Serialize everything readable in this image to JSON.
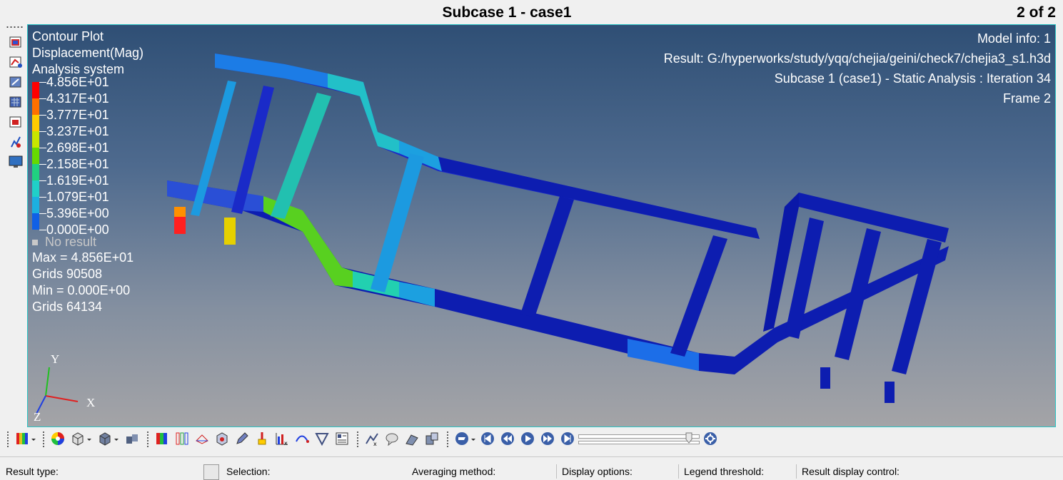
{
  "window": {
    "title": "Subcase 1 - case1",
    "page_count": "2 of 2"
  },
  "contour": {
    "title_lines": [
      "Contour Plot",
      "Displacement(Mag)",
      "Analysis system"
    ],
    "legend": [
      {
        "value": "4.856E+01",
        "color": "#ff0000"
      },
      {
        "value": "4.317E+01",
        "color": "#ff7000"
      },
      {
        "value": "3.777E+01",
        "color": "#ffcc00"
      },
      {
        "value": "3.237E+01",
        "color": "#c8e600"
      },
      {
        "value": "2.698E+01",
        "color": "#66d900"
      },
      {
        "value": "2.158E+01",
        "color": "#20d080"
      },
      {
        "value": "1.619E+01",
        "color": "#20d0c8"
      },
      {
        "value": "1.079E+01",
        "color": "#1cb0e0"
      },
      {
        "value": "5.396E+00",
        "color": "#1060e6"
      },
      {
        "value": "0.000E+00",
        "color": "#0a14a8"
      }
    ],
    "no_result": "No result",
    "stats": [
      "Max = 4.856E+01",
      "Grids 90508",
      "Min = 0.000E+00",
      "Grids 64134"
    ]
  },
  "model_info": [
    "Model info: 1",
    "Result: G:/hyperworks/study/yqq/chejia/geini/check7/chejia3_s1.h3d",
    "Subcase 1 (case1) - Static Analysis : Iteration 34",
    "Frame 2"
  ],
  "axes": {
    "y": "Y",
    "x": "X",
    "z": "Z"
  },
  "left_toolbar_icons": [
    "contour-icon",
    "deformed-icon",
    "vector-icon",
    "tensor-icon",
    "iso-icon",
    "tracing-icon",
    "display-icon"
  ],
  "bottom_toolbar_icons": [
    "contour-legend-icon",
    "color-wheel-icon",
    "mesh-style-icon",
    "shaded-icon",
    "visualization-icon",
    "contour-tool-icon",
    "iso-value-icon",
    "deformed-shape-icon",
    "vector-plot-icon",
    "edit-icon",
    "query-icon",
    "plot-icon",
    "tracing-icon",
    "measure-icon",
    "notes-icon",
    "xy-plot-icon",
    "comment-icon",
    "section-cut-icon",
    "transform-icon",
    "animation-mode-icon",
    "first-frame-icon",
    "previous-frame-icon",
    "play-icon",
    "next-frame-icon",
    "last-frame-icon",
    "animation-settings-icon"
  ],
  "panel": {
    "labels": [
      "Result type:",
      "Selection:",
      "Averaging method:",
      "Display options:",
      "Legend threshold:",
      "Result display control:"
    ]
  },
  "colors": {
    "accent_border": "#2bc5c5",
    "bg_top": "#2f4f75",
    "bg_bottom": "#a4a4a7"
  }
}
